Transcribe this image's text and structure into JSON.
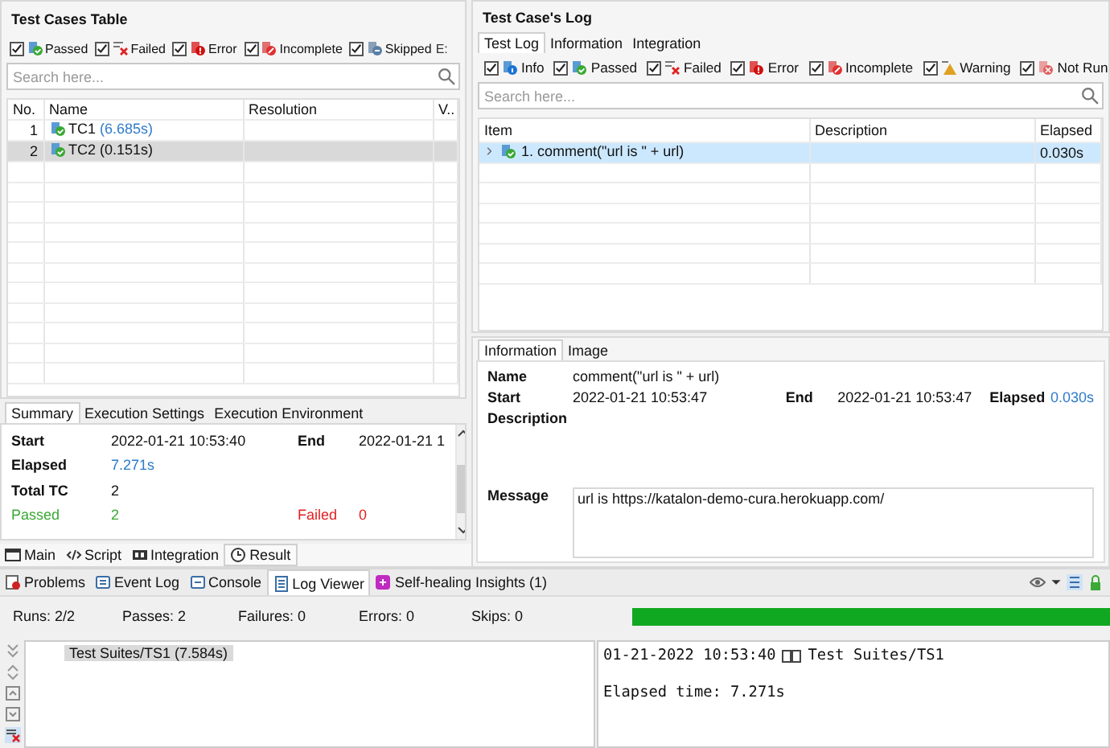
{
  "test_cases_table": {
    "title": "Test Cases Table",
    "filters": [
      {
        "kind": "passed",
        "label": "Passed",
        "checked": true
      },
      {
        "kind": "failed",
        "label": "Failed",
        "checked": true
      },
      {
        "kind": "error",
        "label": "Error",
        "checked": true
      },
      {
        "kind": "incomplete",
        "label": "Incomplete",
        "checked": true
      },
      {
        "kind": "skipped",
        "label": "Skipped",
        "checked": true
      }
    ],
    "filter_cut": "E:",
    "search": {
      "placeholder": "Search here..."
    },
    "columns": [
      "No.",
      "Name",
      "Resolution",
      "V.."
    ],
    "rows": [
      {
        "no": "1",
        "name": "TC1",
        "time": "(6.685s)",
        "selected": false
      },
      {
        "no": "2",
        "name": "TC2",
        "time": "(0.151s)",
        "selected": true
      }
    ]
  },
  "summary": {
    "tabs": [
      {
        "label": "Summary",
        "selected": true
      },
      {
        "label": "Execution Settings",
        "selected": false
      },
      {
        "label": "Execution Environment",
        "selected": false
      }
    ],
    "rows": [
      {
        "cells": [
          {
            "label": "Start",
            "value": "2022-01-21 10:53:40",
            "kind": "plain"
          },
          {
            "label": "End",
            "value": "2022-01-21 1",
            "kind": "plain"
          }
        ]
      },
      {
        "cells": [
          {
            "label": "Elapsed",
            "value": "7.271s",
            "kind": "link"
          }
        ]
      },
      {
        "cells": [
          {
            "label": "Total TC",
            "value": "2",
            "kind": "plain"
          }
        ]
      },
      {
        "cells": [
          {
            "label": "Passed",
            "value": "2",
            "kind": "passed"
          },
          {
            "label": "Failed",
            "value": "0",
            "kind": "failed"
          }
        ]
      }
    ]
  },
  "editor_tabs": [
    {
      "kind": "main",
      "label": "Main",
      "selected": false
    },
    {
      "kind": "script",
      "label": "Script",
      "selected": false
    },
    {
      "kind": "integration",
      "label": "Integration",
      "selected": false
    },
    {
      "kind": "result",
      "label": "Result",
      "selected": true
    }
  ],
  "test_case_log": {
    "title": "Test Case's Log",
    "tabs": [
      {
        "label": "Test Log",
        "selected": true
      },
      {
        "label": "Information",
        "selected": false
      },
      {
        "label": "Integration",
        "selected": false
      }
    ],
    "filters": [
      {
        "kind": "info",
        "label": "Info",
        "checked": true
      },
      {
        "kind": "passed",
        "label": "Passed",
        "checked": true
      },
      {
        "kind": "failed",
        "label": "Failed",
        "checked": true
      },
      {
        "kind": "error",
        "label": "Error",
        "checked": true
      },
      {
        "kind": "incomplete",
        "label": "Incomplete",
        "checked": true
      },
      {
        "kind": "warning",
        "label": "Warning",
        "checked": true
      },
      {
        "kind": "notrun",
        "label": "Not Run",
        "checked": true
      }
    ],
    "search": {
      "placeholder": "Search here..."
    },
    "columns": [
      "Item",
      "Description",
      "Elapsed"
    ],
    "rows": [
      {
        "item": "1. comment(\"url is \" + url)",
        "elapsed": "0.030s",
        "selected": true,
        "expanded": false
      }
    ]
  },
  "details": {
    "tabs": [
      {
        "label": "Information",
        "selected": true
      },
      {
        "label": "Image",
        "selected": false
      }
    ],
    "name_label": "Name",
    "name": "comment(\"url is \" + url)",
    "start_label": "Start",
    "start": "2022-01-21 10:53:47",
    "end_label": "End",
    "end": "2022-01-21 10:53:47",
    "elapsed_label": "Elapsed",
    "elapsed": "0.030s",
    "description_label": "Description",
    "message_label": "Message",
    "message": "url is https://katalon-demo-cura.herokuapp.com/"
  },
  "bottom_panel": {
    "tabs": [
      {
        "kind": "problems",
        "label": "Problems",
        "selected": false
      },
      {
        "kind": "eventlog",
        "label": "Event Log",
        "selected": false
      },
      {
        "kind": "console",
        "label": "Console",
        "selected": false
      },
      {
        "kind": "logviewer",
        "label": "Log Viewer",
        "selected": true
      },
      {
        "kind": "selfhealing",
        "label": "Self-healing Insights (1)",
        "selected": false
      }
    ],
    "stats": [
      "Runs: 2/2",
      "Passes: 2",
      "Failures: 0",
      "Errors: 0",
      "Skips: 0"
    ],
    "progress": {
      "level": 1
    },
    "tree": [
      {
        "label": "Test Suites/TS1 (7.584s)",
        "selected": true
      }
    ],
    "log": [
      {
        "time": "01-21-2022 10:53:40",
        "text": "Test Suites/TS1"
      },
      {
        "text": "Elapsed time: 7.271s"
      }
    ]
  }
}
